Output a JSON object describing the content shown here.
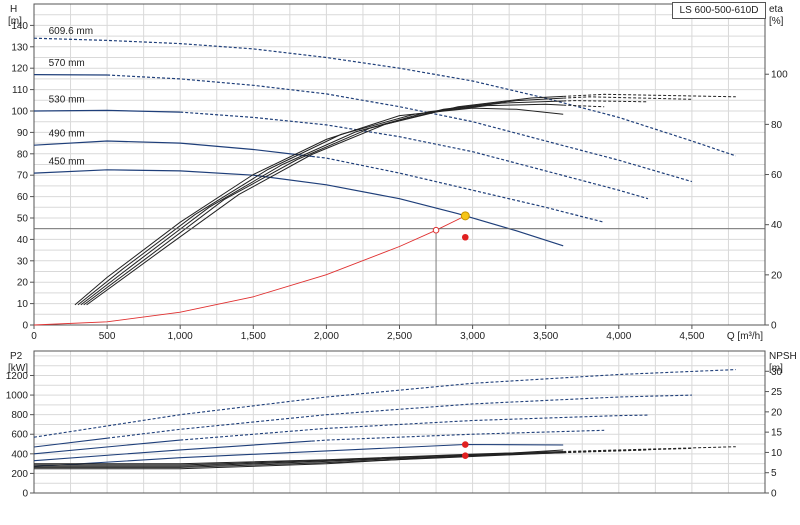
{
  "model_label": "LS 600-500-610D",
  "colors": {
    "grid": "#d9d9d9",
    "frame": "#555555",
    "curve": "#1f3f7a",
    "efficiency": "#222222",
    "system": "#e03030",
    "duty_point": "#e02020",
    "intersection": "#f5c518"
  },
  "chart_data": [
    {
      "type": "line",
      "panel": "pump-curve",
      "left_axis": {
        "title": "H",
        "unit": "[m]",
        "ylim": [
          0,
          150
        ],
        "ticks": [
          0,
          10,
          20,
          30,
          40,
          50,
          60,
          70,
          80,
          90,
          100,
          110,
          120,
          130,
          140
        ]
      },
      "right_axis": {
        "title": "eta",
        "unit": "[%]",
        "ylim": [
          0,
          128
        ],
        "ticks": [
          0,
          20,
          40,
          60,
          80,
          100
        ]
      },
      "x_axis": {
        "title": "Q [m³/h]",
        "xlim": [
          0,
          5000
        ],
        "ticks": [
          0,
          500,
          1000,
          1500,
          2000,
          2500,
          3000,
          3500,
          4000,
          4500
        ],
        "tick_labels": [
          "0",
          "500",
          "1,000",
          "1,500",
          "2,000",
          "2,500",
          "3,000",
          "3,500",
          "4,000",
          "4,500"
        ]
      },
      "grid": true,
      "head_curves": [
        {
          "label": "609.6 mm",
          "label_at": [
            100,
            136
          ],
          "solid_until": 0,
          "points": [
            [
              0,
              134
            ],
            [
              500,
              133
            ],
            [
              1000,
              131.5
            ],
            [
              1500,
              129
            ],
            [
              2000,
              125
            ],
            [
              2500,
              120
            ],
            [
              3000,
              114
            ],
            [
              3500,
              106
            ],
            [
              4000,
              97
            ],
            [
              4500,
              86
            ],
            [
              4800,
              79
            ]
          ]
        },
        {
          "label": "570 mm",
          "label_at": [
            100,
            121
          ],
          "solid_until": 500,
          "points": [
            [
              0,
              117
            ],
            [
              500,
              116.8
            ],
            [
              1000,
              115
            ],
            [
              1500,
              112
            ],
            [
              2000,
              108
            ],
            [
              2500,
              102
            ],
            [
              3000,
              95
            ],
            [
              3500,
              86
            ],
            [
              4000,
              77
            ],
            [
              4500,
              67
            ]
          ]
        },
        {
          "label": "530 mm",
          "label_at": [
            100,
            104
          ],
          "solid_until": 1000,
          "points": [
            [
              0,
              100
            ],
            [
              500,
              100.3
            ],
            [
              1000,
              99.5
            ],
            [
              1500,
              97
            ],
            [
              2000,
              93.5
            ],
            [
              2500,
              88
            ],
            [
              3000,
              81
            ],
            [
              3500,
              72
            ],
            [
              4000,
              63
            ],
            [
              4200,
              59
            ]
          ]
        },
        {
          "label": "490 mm",
          "label_at": [
            100,
            88
          ],
          "solid_until": 1900,
          "points": [
            [
              0,
              84
            ],
            [
              500,
              86
            ],
            [
              1000,
              85
            ],
            [
              1500,
              82
            ],
            [
              2000,
              78
            ],
            [
              2500,
              71
            ],
            [
              3000,
              63
            ],
            [
              3500,
              55
            ],
            [
              3900,
              48
            ]
          ]
        },
        {
          "label": "450 mm",
          "label_at": [
            100,
            75
          ],
          "solid_until": 3620,
          "points": [
            [
              0,
              71
            ],
            [
              500,
              72.5
            ],
            [
              1000,
              72
            ],
            [
              1500,
              70
            ],
            [
              2000,
              65.5
            ],
            [
              2500,
              59
            ],
            [
              2900,
              52
            ],
            [
              3300,
              44
            ],
            [
              3620,
              37
            ]
          ]
        }
      ],
      "efficiency_curves": [
        {
          "points": [
            [
              280,
              8
            ],
            [
              500,
              19
            ],
            [
              1000,
              41
            ],
            [
              1500,
              60
            ],
            [
              2000,
              74
            ],
            [
              2500,
              83.5
            ],
            [
              3000,
              86.5
            ],
            [
              3300,
              86
            ],
            [
              3620,
              84
            ]
          ]
        },
        {
          "points": [
            [
              300,
              8
            ],
            [
              600,
              22
            ],
            [
              1100,
              44
            ],
            [
              1600,
              62
            ],
            [
              2100,
              76
            ],
            [
              2600,
              84
            ],
            [
              3100,
              87.5
            ],
            [
              3500,
              88
            ],
            [
              3900,
              87
            ]
          ],
          "dashed_from": 3620
        },
        {
          "points": [
            [
              320,
              8
            ],
            [
              700,
              25
            ],
            [
              1200,
              47
            ],
            [
              1700,
              64
            ],
            [
              2200,
              77
            ],
            [
              2700,
              85
            ],
            [
              3200,
              88.5
            ],
            [
              3700,
              89.5
            ],
            [
              4200,
              89
            ]
          ],
          "dashed_from": 3620
        },
        {
          "points": [
            [
              340,
              8
            ],
            [
              800,
              28
            ],
            [
              1300,
              50
            ],
            [
              1800,
              66
            ],
            [
              2300,
              78.5
            ],
            [
              2800,
              86
            ],
            [
              3300,
              89.5
            ],
            [
              3800,
              91
            ],
            [
              4500,
              90
            ]
          ],
          "dashed_from": 3620
        },
        {
          "points": [
            [
              360,
              8
            ],
            [
              900,
              31
            ],
            [
              1400,
              52
            ],
            [
              1900,
              68
            ],
            [
              2400,
              80
            ],
            [
              2900,
              87
            ],
            [
              3400,
              90.5
            ],
            [
              3900,
              92
            ],
            [
              4800,
              91
            ]
          ],
          "dashed_from": 3620
        }
      ],
      "system_curve": {
        "points": [
          [
            0,
            0
          ],
          [
            500,
            1.5
          ],
          [
            1000,
            6
          ],
          [
            1500,
            13.2
          ],
          [
            2000,
            23.5
          ],
          [
            2500,
            36.7
          ],
          [
            2750,
            44.3
          ],
          [
            2950,
            51
          ]
        ]
      },
      "reference_lines": {
        "horizontal_h": 45,
        "vertical_q": 2750
      },
      "markers": [
        {
          "kind": "intersection",
          "x": 2950,
          "y": 51
        },
        {
          "kind": "duty",
          "x": 2950,
          "y": 41
        },
        {
          "kind": "open",
          "x": 2750,
          "y": 44.3
        }
      ]
    },
    {
      "type": "line",
      "panel": "power-npsh",
      "left_axis": {
        "title": "P2",
        "unit": "[kW]",
        "ylim": [
          0,
          1450
        ],
        "ticks": [
          0,
          200,
          400,
          600,
          800,
          1000,
          1200
        ]
      },
      "right_axis": {
        "title": "NPSH",
        "unit": "[m]",
        "ylim": [
          0,
          35
        ],
        "ticks": [
          0,
          5,
          10,
          15,
          20,
          25,
          30
        ]
      },
      "x_axis": {
        "xlim": [
          0,
          5000
        ]
      },
      "grid": true,
      "power_curves": [
        {
          "solid_until": 0,
          "points": [
            [
              0,
              570
            ],
            [
              1000,
              800
            ],
            [
              2000,
              980
            ],
            [
              3000,
              1120
            ],
            [
              4000,
              1210
            ],
            [
              4800,
              1260
            ]
          ]
        },
        {
          "solid_until": 500,
          "points": [
            [
              0,
              470
            ],
            [
              1000,
              650
            ],
            [
              2000,
              800
            ],
            [
              3000,
              910
            ],
            [
              4000,
              980
            ],
            [
              4500,
              1000
            ]
          ]
        },
        {
          "solid_until": 1000,
          "points": [
            [
              0,
              400
            ],
            [
              1000,
              540
            ],
            [
              2000,
              660
            ],
            [
              3000,
              740
            ],
            [
              4000,
              790
            ],
            [
              4200,
              795
            ]
          ]
        },
        {
          "solid_until": 1900,
          "points": [
            [
              0,
              330
            ],
            [
              1000,
              440
            ],
            [
              2000,
              540
            ],
            [
              3000,
              600
            ],
            [
              3900,
              640
            ]
          ]
        },
        {
          "solid_until": 3620,
          "points": [
            [
              0,
              270
            ],
            [
              1000,
              360
            ],
            [
              2000,
              430
            ],
            [
              2950,
              495
            ],
            [
              3620,
              490
            ]
          ]
        }
      ],
      "npsh_curves": [
        {
          "points": [
            [
              0,
              6
            ],
            [
              1000,
              6
            ],
            [
              2000,
              7.2
            ],
            [
              2950,
              9.2
            ],
            [
              3620,
              10.6
            ]
          ]
        },
        {
          "points": [
            [
              0,
              6.3
            ],
            [
              1000,
              6.3
            ],
            [
              2000,
              7.5
            ],
            [
              3000,
              9
            ],
            [
              3900,
              10.4
            ]
          ],
          "dashed_from": 3620
        },
        {
          "points": [
            [
              0,
              6.6
            ],
            [
              1000,
              6.6
            ],
            [
              2000,
              7.8
            ],
            [
              3000,
              9.2
            ],
            [
              4200,
              10.6
            ]
          ],
          "dashed_from": 3620
        },
        {
          "points": [
            [
              0,
              6.9
            ],
            [
              1000,
              6.9
            ],
            [
              2000,
              8
            ],
            [
              3000,
              9.4
            ],
            [
              4500,
              11
            ]
          ],
          "dashed_from": 3620
        },
        {
          "points": [
            [
              0,
              7.2
            ],
            [
              1000,
              7.2
            ],
            [
              2000,
              8.2
            ],
            [
              3000,
              9.6
            ],
            [
              4800,
              11.4
            ]
          ],
          "dashed_from": 3620
        }
      ],
      "markers": [
        {
          "kind": "duty",
          "axis": "left",
          "x": 2950,
          "y": 495
        },
        {
          "kind": "duty",
          "axis": "right",
          "x": 2950,
          "y": 9.2
        }
      ]
    }
  ]
}
